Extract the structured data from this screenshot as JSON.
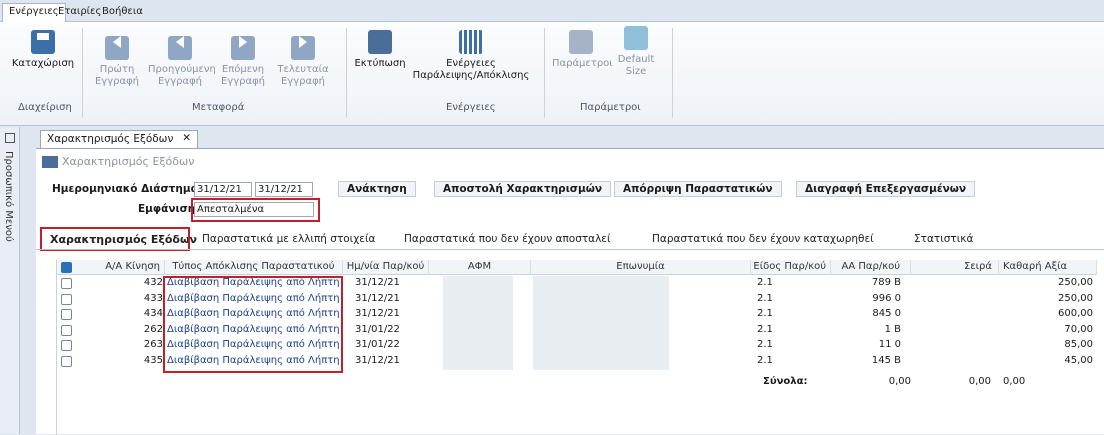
{
  "ribbon_tabs": [
    "Ενέργειες",
    "Εταιρίες",
    "Βοήθεια"
  ],
  "ribbon": {
    "save": "Καταχώριση",
    "first": [
      "Πρώτη",
      "Εγγραφή"
    ],
    "prev": [
      "Προηγούμενη",
      "Εγγραφή"
    ],
    "next": [
      "Επόμενη",
      "Εγγραφή"
    ],
    "last": [
      "Τελευταία",
      "Εγγραφή"
    ],
    "print": "Εκτύπωση",
    "actions": [
      "Ενέργειες",
      "Παράλειψης/Απόκλισης"
    ],
    "params": "Παράμετροι",
    "default_size": [
      "Default",
      "Size"
    ],
    "groups": {
      "manage": "Διαχείριση",
      "transfer": "Μεταφορά",
      "actions": "Ενέργειες",
      "params": "Παράμετροι"
    }
  },
  "side_menu": "Προσωπικό Μενού",
  "doc_tab": "Χαρακτηρισμός Εξόδων",
  "doc_close": "✕",
  "form": {
    "title": "Χαρακτηρισμός Εξόδων",
    "date_label": "Ημερομηνιακό Διάστημα",
    "date_from": "31/12/21",
    "date_to": "31/12/21",
    "view_label": "Εμφάνιση",
    "view_value": "Απεσταλμένα",
    "buttons": [
      "Ανάκτηση",
      "Αποστολή Χαρακτηρισμών",
      "Απόρριψη Παραστατικών",
      "Διαγραφή Επεξεργασμένων"
    ]
  },
  "subtabs": [
    "Χαρακτηρισμός Εξόδων",
    "Παραστατικά με ελλιπή στοιχεία",
    "Παραστατικά που δεν έχουν αποσταλεί",
    "Παραστατικά που δεν έχουν καταχωρηθεί",
    "Στατιστικά"
  ],
  "table": {
    "headers": [
      "Α/Α Κίνηση",
      "Τύπος Απόκλισης Παραστατικού",
      "Ημ/νία Παρ/κού",
      "ΑΦΜ",
      "Επωνυμία",
      "Είδος Παρ/κού",
      "ΑΑ Παρ/κού",
      "Σειρά",
      "Καθαρή Αξία"
    ],
    "rows": [
      [
        "432",
        "Διαβίβαση Παράλειψης από Λήπτη",
        "31/12/21",
        "2.1",
        "789 B",
        "250,00"
      ],
      [
        "433",
        "Διαβίβαση Παράλειψης από Λήπτη",
        "31/12/21",
        "2.1",
        "996 0",
        "250,00"
      ],
      [
        "434",
        "Διαβίβαση Παράλειψης από Λήπτη",
        "31/12/21",
        "2.1",
        "845 0",
        "600,00"
      ],
      [
        "262",
        "Διαβίβαση Παράλειψης από Λήπτη",
        "31/01/22",
        "2.1",
        "1 B",
        "70,00"
      ],
      [
        "263",
        "Διαβίβαση Παράλειψης από Λήπτη",
        "31/01/22",
        "2.1",
        "11 0",
        "85,00"
      ],
      [
        "435",
        "Διαβίβαση Παράλειψης από Λήπτη",
        "31/12/21",
        "2.1",
        "145 B",
        "45,00"
      ]
    ],
    "totals_label": "Σύνολα:",
    "totals": [
      "0,00",
      "0,00",
      "0,00"
    ]
  }
}
